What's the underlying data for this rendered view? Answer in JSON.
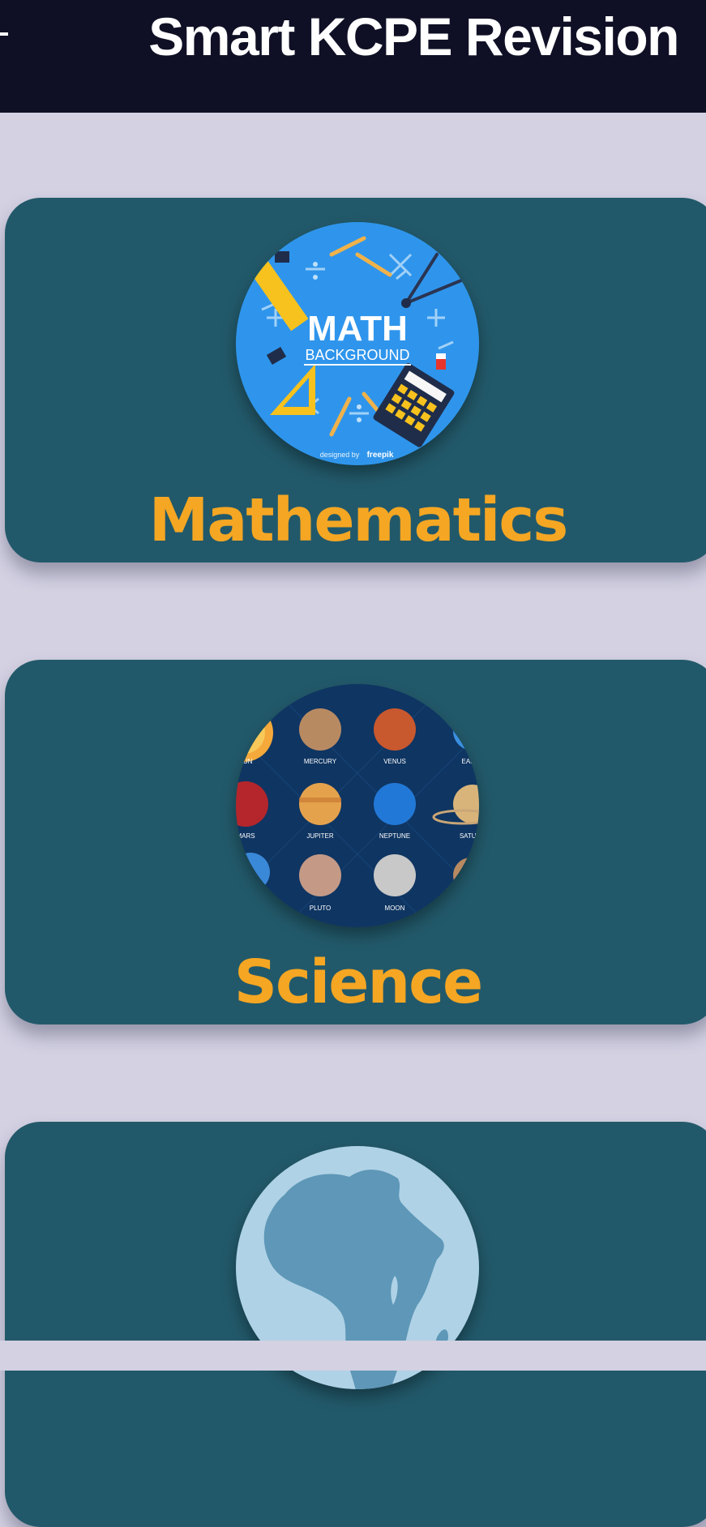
{
  "header": {
    "title": "Smart KCPE Revision",
    "menu_icon": "menu-icon"
  },
  "subjects": [
    {
      "name": "Mathematics",
      "image": {
        "icon": "math-background-image",
        "heading": "MATH",
        "subheading": "BACKGROUND",
        "credit": "designed by",
        "credit_brand": "freepik"
      }
    },
    {
      "name": "Science",
      "image": {
        "icon": "solar-system-image",
        "planets": [
          "SUN",
          "MERCURY",
          "VENUS",
          "EARTH",
          "MARS",
          "JUPITER",
          "NEPTUNE",
          "SATURN",
          "PLUTO",
          "MOON"
        ]
      }
    },
    {
      "name": "",
      "image": {
        "icon": "africa-globe-image"
      }
    }
  ],
  "colors": {
    "background": "#d3d1e2",
    "header": "#0f1025",
    "card": "#22596a",
    "accent": "#f5a623"
  }
}
